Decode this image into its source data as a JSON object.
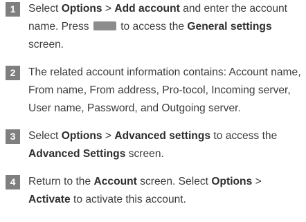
{
  "steps": [
    {
      "number": "1",
      "segments": [
        {
          "t": "Select ",
          "bold": false
        },
        {
          "t": "Options",
          "bold": true
        },
        {
          "t": " > ",
          "bold": false
        },
        {
          "t": "Add account",
          "bold": true
        },
        {
          "t": " and enter the account name. Press ",
          "bold": false
        },
        {
          "key": "softkey-icon"
        },
        {
          "t": " to access the ",
          "bold": false
        },
        {
          "t": "General settings",
          "bold": true
        },
        {
          "t": " screen.",
          "bold": false
        }
      ]
    },
    {
      "number": "2",
      "segments": [
        {
          "t": "The related account information contains: Account name, From name, From address, Pro-tocol, Incoming server, User name, Password, and Outgoing server.",
          "bold": false
        }
      ]
    },
    {
      "number": "3",
      "segments": [
        {
          "t": "Select ",
          "bold": false
        },
        {
          "t": "Options",
          "bold": true
        },
        {
          "t": " > ",
          "bold": false
        },
        {
          "t": "Advanced settings",
          "bold": true
        },
        {
          "t": " to access the ",
          "bold": false
        },
        {
          "t": "Advanced Settings",
          "bold": true
        },
        {
          "t": " screen.",
          "bold": false
        }
      ]
    },
    {
      "number": "4",
      "segments": [
        {
          "t": "Return to the ",
          "bold": false
        },
        {
          "t": "Account",
          "bold": true
        },
        {
          "t": " screen. Select ",
          "bold": false
        },
        {
          "t": "Options",
          "bold": true
        },
        {
          "t": " > ",
          "bold": false
        },
        {
          "t": "Activate",
          "bold": true
        },
        {
          "t": " to activate this account.",
          "bold": false
        }
      ]
    }
  ]
}
